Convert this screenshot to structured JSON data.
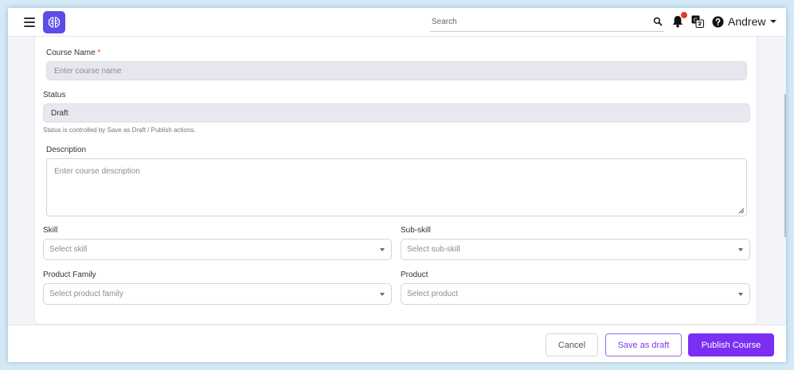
{
  "topbar": {
    "search_placeholder": "Search",
    "user_name": "Andrew",
    "icons": [
      "menu-icon",
      "brain-logo-icon",
      "search-icon",
      "bell-icon",
      "translate-icon",
      "help-icon",
      "caret-down-icon"
    ]
  },
  "form": {
    "course_name": {
      "label": "Course Name",
      "required_mark": "*",
      "placeholder": "Enter course name"
    },
    "status": {
      "label": "Status",
      "value": "Draft",
      "hint": "Status is controlled by Save as Draft / Publish actions."
    },
    "description": {
      "label": "Description",
      "placeholder": "Enter course description"
    },
    "skill": {
      "label": "Skill",
      "placeholder": "Select skill"
    },
    "sub_skill": {
      "label": "Sub-skill",
      "placeholder": "Select sub-skill"
    },
    "product_family": {
      "label": "Product Family",
      "placeholder": "Select product family"
    },
    "product": {
      "label": "Product",
      "placeholder": "Select product"
    }
  },
  "footer": {
    "cancel_label": "Cancel",
    "save_draft_label": "Save as draft",
    "publish_label": "Publish Course"
  },
  "colors": {
    "accent": "#7b2ff2",
    "logo_bg": "#5b4de6",
    "notification_dot": "#e53935",
    "required": "#e53935"
  }
}
